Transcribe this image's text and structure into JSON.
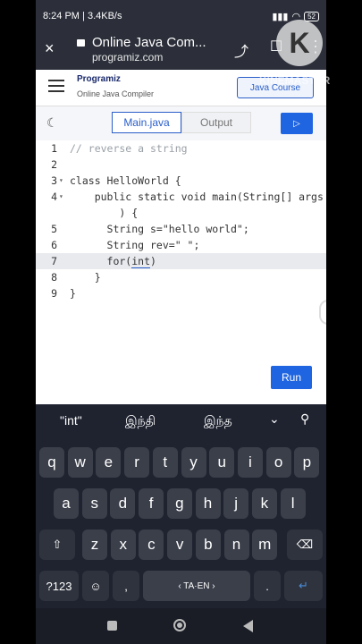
{
  "status": {
    "time": "8:24 PM",
    "speed": "3.4KB/s",
    "battery": "52"
  },
  "chrome": {
    "title": "Online Java Com...",
    "url": "programiz.com",
    "close": "×",
    "share": "⤴",
    "bookmark": "☐",
    "more": "⋮"
  },
  "watermark": {
    "badge": "K",
    "text": "KINEMASTER"
  },
  "site": {
    "logo": "Programiz",
    "subtitle": "Online Java Compiler",
    "course_button": "Java Course"
  },
  "tabs": {
    "file": "Main.java",
    "output": "Output",
    "run_icon": "▷"
  },
  "editor": {
    "lines": [
      {
        "num": "1",
        "text": "// reverse a string",
        "comment": true
      },
      {
        "num": "2",
        "text": ""
      },
      {
        "num": "3",
        "text": "class HelloWorld {",
        "fold": true
      },
      {
        "num": "4",
        "text": "    public static void main(String[] args",
        "fold": true
      },
      {
        "num": "",
        "text": "        ) {"
      },
      {
        "num": "5",
        "text": "      String s=\"hello world\";"
      },
      {
        "num": "6",
        "text": "      String rev=\" \";"
      },
      {
        "num": "7",
        "text_before": "      for(",
        "text_word": "int",
        "text_after": ")",
        "active": true
      },
      {
        "num": "8",
        "text": "    }"
      },
      {
        "num": "9",
        "text": "}"
      }
    ],
    "run_button": "Run"
  },
  "keyboard": {
    "suggestions": [
      "\"int\"",
      "இந்தி",
      "இந்த"
    ],
    "row1": [
      "q",
      "w",
      "e",
      "r",
      "t",
      "y",
      "u",
      "i",
      "o",
      "p"
    ],
    "row2": [
      "a",
      "s",
      "d",
      "f",
      "g",
      "h",
      "j",
      "k",
      "l"
    ],
    "row3": [
      "z",
      "x",
      "c",
      "v",
      "b",
      "n",
      "m"
    ],
    "shift": "⇧",
    "backspace": "⌫",
    "sym": "?123",
    "emoji": "☺",
    "comma": ",",
    "space": "‹  TA·EN  ›",
    "period": ".",
    "enter": "↵"
  }
}
